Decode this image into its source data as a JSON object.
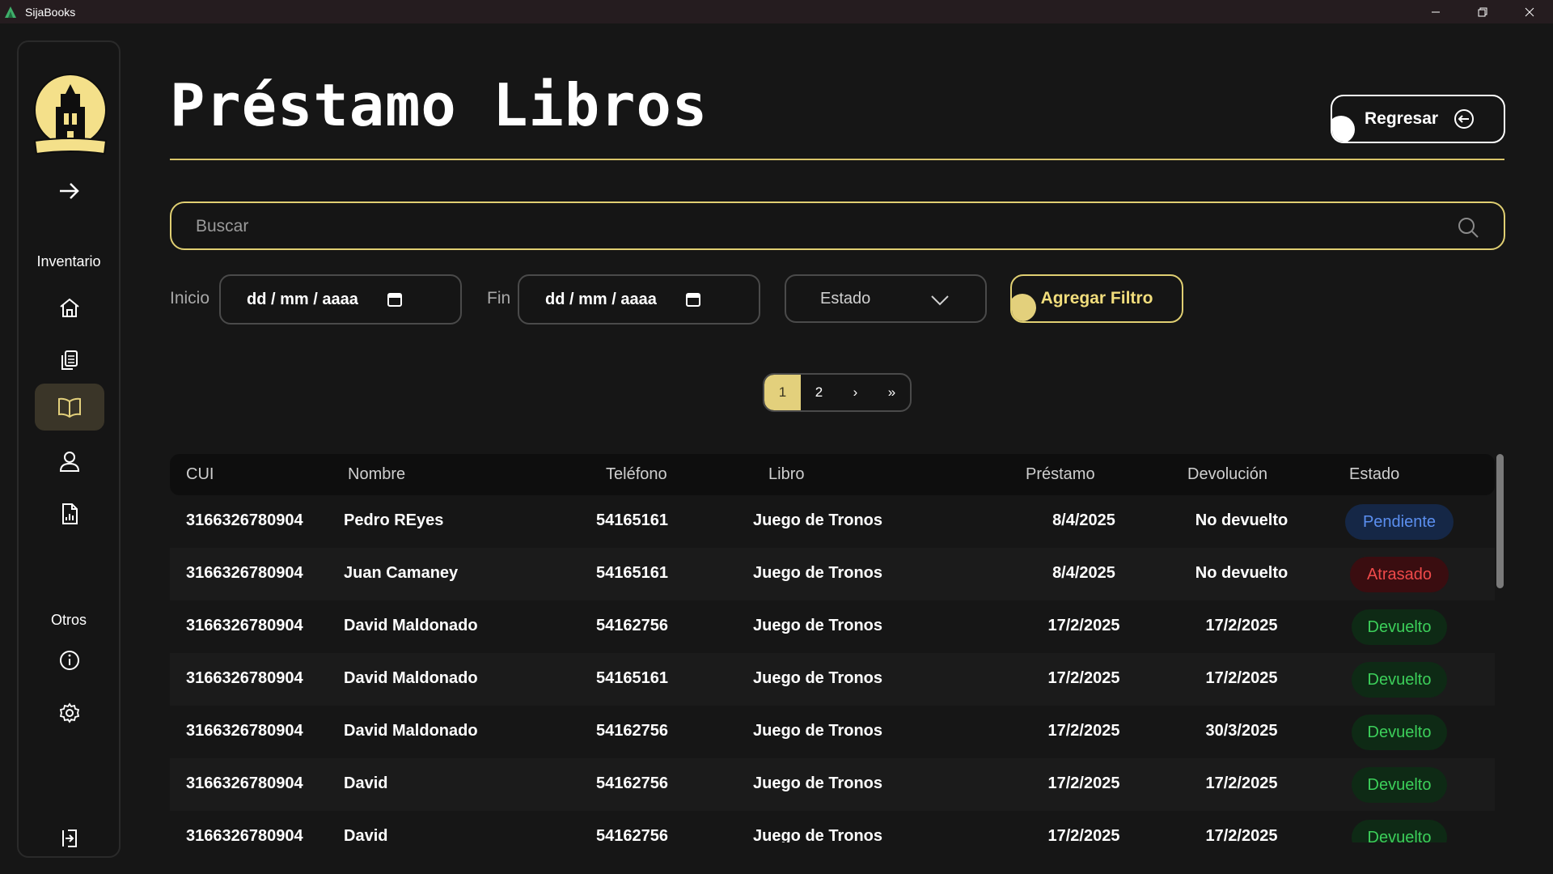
{
  "window": {
    "title": "SijaBooks"
  },
  "sidebar": {
    "sections": {
      "inventario": "Inventario",
      "otros": "Otros"
    }
  },
  "header": {
    "title": "Préstamo Libros",
    "back_label": "Regresar"
  },
  "search": {
    "placeholder": "Buscar",
    "value": ""
  },
  "filters": {
    "start_label": "Inicio",
    "start_value": "dd / mm / aaaa",
    "end_label": "Fin",
    "end_value": "dd / mm / aaaa",
    "state_value": "Estado",
    "add_filter_label": "Agregar Filtro"
  },
  "pagination": {
    "pages": [
      "1",
      "2"
    ],
    "next": "›",
    "last": "»",
    "current": "1"
  },
  "table": {
    "columns": [
      "CUI",
      "Nombre",
      "Teléfono",
      "Libro",
      "Préstamo",
      "Devolución",
      "Estado"
    ],
    "rows": [
      {
        "cui": "3166326780904",
        "nombre": "Pedro REyes",
        "telefono": "54165161",
        "libro": "Juego de Tronos",
        "prestamo": "8/4/2025",
        "devolucion": "No devuelto",
        "estado": "Pendiente"
      },
      {
        "cui": "3166326780904",
        "nombre": "Juan Camaney",
        "telefono": "54165161",
        "libro": "Juego de Tronos",
        "prestamo": "8/4/2025",
        "devolucion": "No devuelto",
        "estado": "Atrasado"
      },
      {
        "cui": "3166326780904",
        "nombre": "David Maldonado",
        "telefono": "54162756",
        "libro": "Juego de Tronos",
        "prestamo": "17/2/2025",
        "devolucion": "17/2/2025",
        "estado": "Devuelto"
      },
      {
        "cui": "3166326780904",
        "nombre": "David Maldonado",
        "telefono": "54165161",
        "libro": "Juego de Tronos",
        "prestamo": "17/2/2025",
        "devolucion": "17/2/2025",
        "estado": "Devuelto"
      },
      {
        "cui": "3166326780904",
        "nombre": "David Maldonado",
        "telefono": "54162756",
        "libro": "Juego de Tronos",
        "prestamo": "17/2/2025",
        "devolucion": "30/3/2025",
        "estado": "Devuelto"
      },
      {
        "cui": "3166326780904",
        "nombre": "David",
        "telefono": "54162756",
        "libro": "Juego de Tronos",
        "prestamo": "17/2/2025",
        "devolucion": "17/2/2025",
        "estado": "Devuelto"
      },
      {
        "cui": "3166326780904",
        "nombre": "David",
        "telefono": "54162756",
        "libro": "Juego de Tronos",
        "prestamo": "17/2/2025",
        "devolucion": "17/2/2025",
        "estado": "Devuelto"
      }
    ]
  },
  "colors": {
    "accent": "#e0cf72",
    "pendiente": "#5b8ff0",
    "atrasado": "#f04a4a",
    "devuelto": "#3ccf5a"
  }
}
